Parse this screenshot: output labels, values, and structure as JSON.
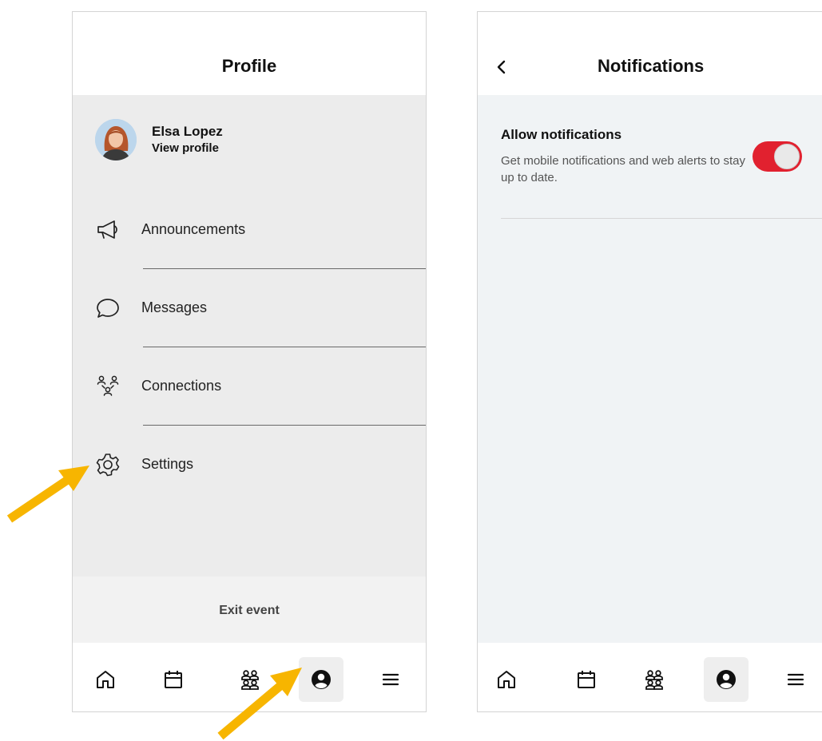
{
  "left_screen": {
    "title": "Profile",
    "user": {
      "name": "Elsa Lopez",
      "link": "View profile"
    },
    "menu": [
      {
        "label": "Announcements",
        "icon": "megaphone-icon"
      },
      {
        "label": "Messages",
        "icon": "chat-bubble-icon"
      },
      {
        "label": "Connections",
        "icon": "people-network-icon"
      },
      {
        "label": "Settings",
        "icon": "gear-icon"
      }
    ],
    "exit_label": "Exit event"
  },
  "right_screen": {
    "title": "Notifications",
    "setting": {
      "title": "Allow notifications",
      "description": "Get mobile notifications and web alerts to stay up to date.",
      "enabled": true
    }
  },
  "tabbar": {
    "tabs": [
      {
        "icon": "home-icon"
      },
      {
        "icon": "calendar-icon"
      },
      {
        "icon": "people-icon"
      },
      {
        "icon": "profile-icon",
        "active": true
      },
      {
        "icon": "menu-icon"
      }
    ]
  },
  "colors": {
    "accent": "#e1212f",
    "annotation_arrow": "#f7b500",
    "menu_background": "#ececec",
    "settings_background": "#f0f3f5"
  }
}
